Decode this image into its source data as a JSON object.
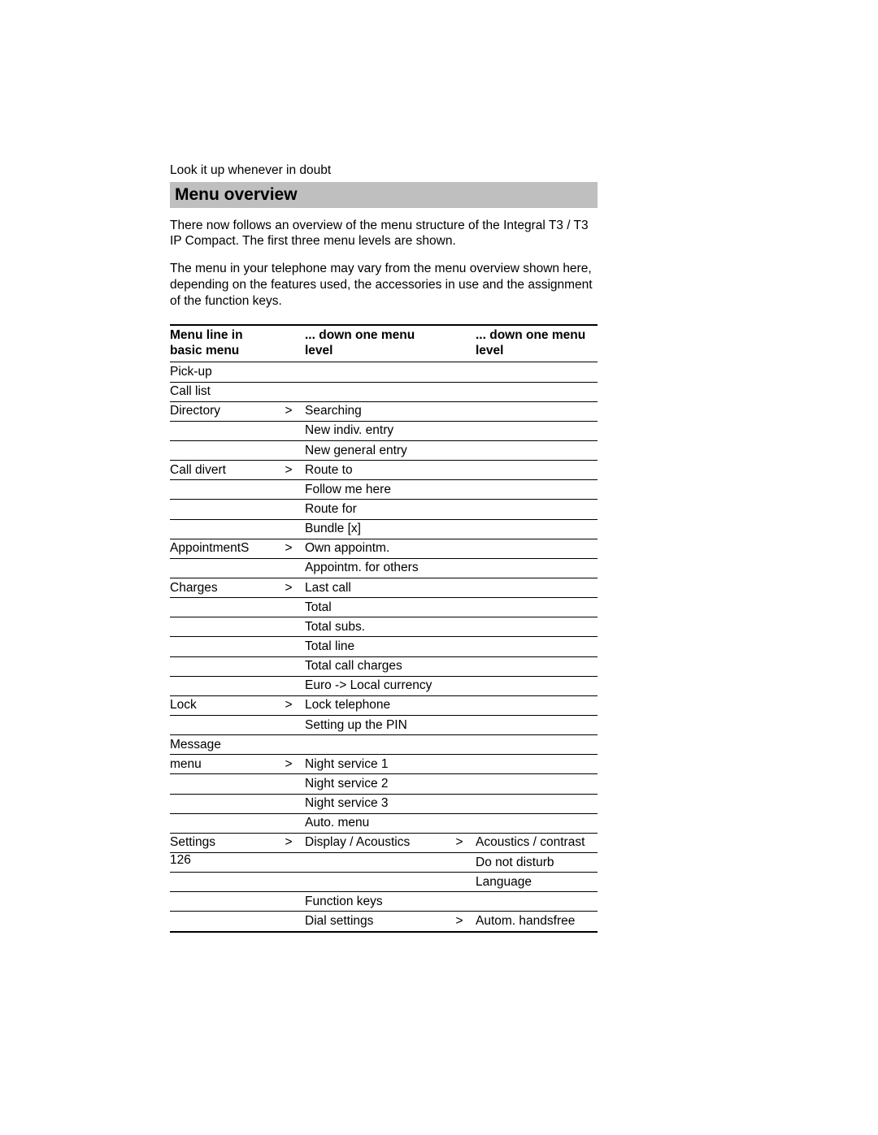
{
  "small_header": "Look it up whenever in doubt",
  "title": "Menu overview",
  "para1": "There now follows an overview of the menu structure of the Integral T3 / T3 IP Compact. The first three menu levels are shown.",
  "para2": "The menu in your telephone may vary from the menu overview shown here, depending on the features used, the accessories in use and the assignment of the function keys.",
  "headers": {
    "col1": "Menu line in basic menu",
    "col2": "... down one menu level",
    "col3": "... down one menu level"
  },
  "gt": ">",
  "rows": [
    {
      "basic": "Pick-up",
      "gt1": "",
      "l2": "",
      "gt2": "",
      "l3": ""
    },
    {
      "basic": "Call list",
      "gt1": "",
      "l2": "",
      "gt2": "",
      "l3": ""
    },
    {
      "basic": "Directory",
      "gt1": ">",
      "l2": "Searching",
      "gt2": "",
      "l3": ""
    },
    {
      "basic": "",
      "gt1": "",
      "l2": "New indiv. entry",
      "gt2": "",
      "l3": ""
    },
    {
      "basic": "",
      "gt1": "",
      "l2": "New general entry",
      "gt2": "",
      "l3": ""
    },
    {
      "basic": "Call divert",
      "gt1": ">",
      "l2": "Route to",
      "gt2": "",
      "l3": ""
    },
    {
      "basic": "",
      "gt1": "",
      "l2": "Follow me here",
      "gt2": "",
      "l3": ""
    },
    {
      "basic": "",
      "gt1": "",
      "l2": "Route for",
      "gt2": "",
      "l3": ""
    },
    {
      "basic": "",
      "gt1": "",
      "l2": "Bundle [x]",
      "gt2": "",
      "l3": ""
    },
    {
      "basic": "AppointmentS",
      "gt1": ">",
      "l2": "Own appointm.",
      "gt2": "",
      "l3": ""
    },
    {
      "basic": "",
      "gt1": "",
      "l2": "Appointm. for others",
      "gt2": "",
      "l3": ""
    },
    {
      "basic": "Charges",
      "gt1": ">",
      "l2": "Last call",
      "gt2": "",
      "l3": ""
    },
    {
      "basic": "",
      "gt1": "",
      "l2": "Total",
      "gt2": "",
      "l3": ""
    },
    {
      "basic": "",
      "gt1": "",
      "l2": "Total subs.",
      "gt2": "",
      "l3": ""
    },
    {
      "basic": "",
      "gt1": "",
      "l2": "Total line",
      "gt2": "",
      "l3": ""
    },
    {
      "basic": "",
      "gt1": "",
      "l2": "Total call charges",
      "gt2": "",
      "l3": ""
    },
    {
      "basic": "",
      "gt1": "",
      "l2": "Euro -> Local currency",
      "gt2": "",
      "l3": ""
    },
    {
      "basic": "Lock",
      "gt1": ">",
      "l2": "Lock telephone",
      "gt2": "",
      "l3": ""
    },
    {
      "basic": "",
      "gt1": "",
      "l2": "Setting up the PIN",
      "gt2": "",
      "l3": ""
    },
    {
      "basic": "Message",
      "gt1": "",
      "l2": "",
      "gt2": "",
      "l3": ""
    },
    {
      "basic": "menu",
      "gt1": ">",
      "l2": "Night service 1",
      "gt2": "",
      "l3": ""
    },
    {
      "basic": "",
      "gt1": "",
      "l2": "Night service 2",
      "gt2": "",
      "l3": ""
    },
    {
      "basic": "",
      "gt1": "",
      "l2": "Night service 3",
      "gt2": "",
      "l3": ""
    },
    {
      "basic": "",
      "gt1": "",
      "l2": "Auto. menu",
      "gt2": "",
      "l3": ""
    },
    {
      "basic": "Settings",
      "gt1": ">",
      "l2": "Display / Acoustics",
      "gt2": ">",
      "l3": "Acoustics / contrast"
    },
    {
      "basic": "",
      "gt1": "",
      "l2": "",
      "gt2": "",
      "l3": "Do not disturb"
    },
    {
      "basic": "",
      "gt1": "",
      "l2": "",
      "gt2": "",
      "l3": "Language"
    },
    {
      "basic": "",
      "gt1": "",
      "l2": "Function keys",
      "gt2": "",
      "l3": ""
    },
    {
      "basic": "",
      "gt1": "",
      "l2": "Dial settings",
      "gt2": ">",
      "l3": "Autom. handsfree"
    }
  ],
  "page_number": "126"
}
